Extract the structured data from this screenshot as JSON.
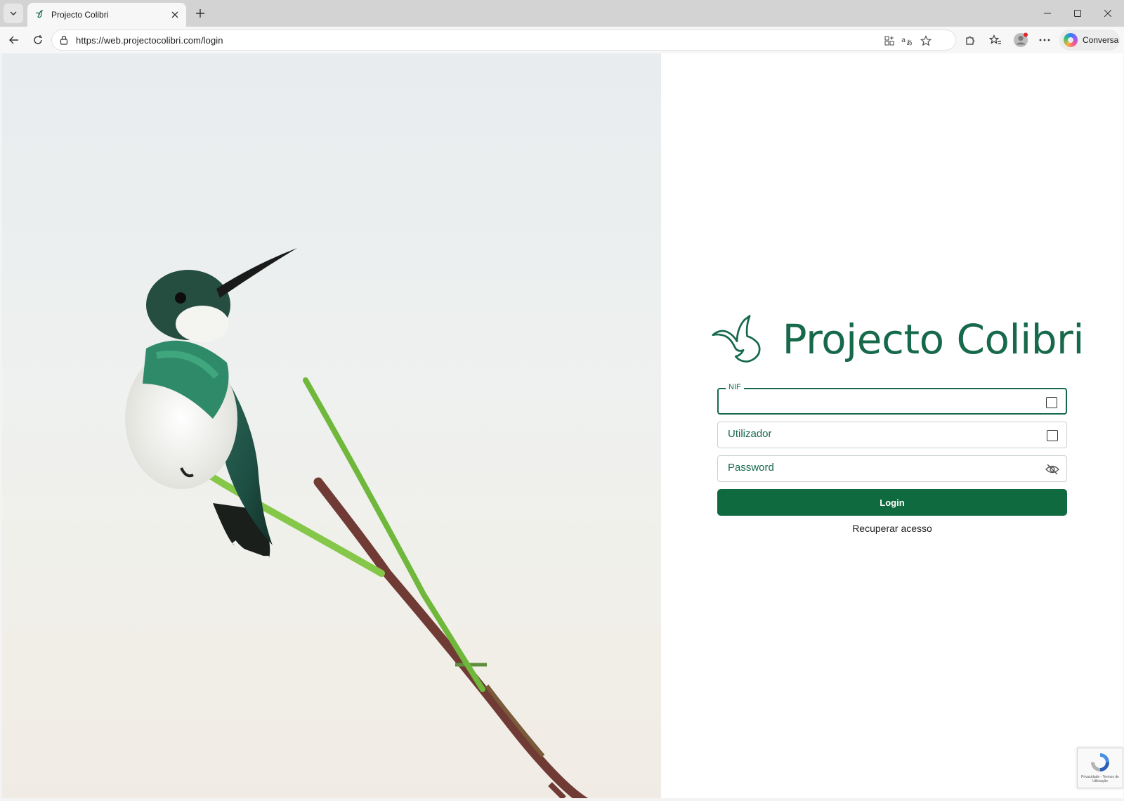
{
  "browser": {
    "tab_title": "Projecto Colibri",
    "url": "https://web.projectocolibri.com/login",
    "copilot_label": "Conversa"
  },
  "page": {
    "logo_text": "Projecto Colibri",
    "fields": {
      "nif": {
        "label": "NIF",
        "value": ""
      },
      "user": {
        "label": "Utilizador",
        "value": ""
      },
      "password": {
        "label": "Password",
        "value": ""
      }
    },
    "login_label": "Login",
    "recover_label": "Recuperar acesso",
    "recaptcha_text": "Privacidade - Termos de Utilização"
  },
  "colors": {
    "brand_green": "#16694a",
    "button_green": "#0f6a3f"
  },
  "icons": [
    "tab-list-icon",
    "favicon-icon",
    "close-icon",
    "plus-icon",
    "minimize-icon",
    "maximize-icon",
    "window-close-icon",
    "back-icon",
    "refresh-icon",
    "lock-icon",
    "app-available-icon",
    "translate-icon",
    "favorite-star-icon",
    "extensions-icon",
    "favorites-icon",
    "profile-icon",
    "more-icon",
    "copilot-icon",
    "square-icon",
    "eye-off-icon",
    "recaptcha-icon"
  ]
}
